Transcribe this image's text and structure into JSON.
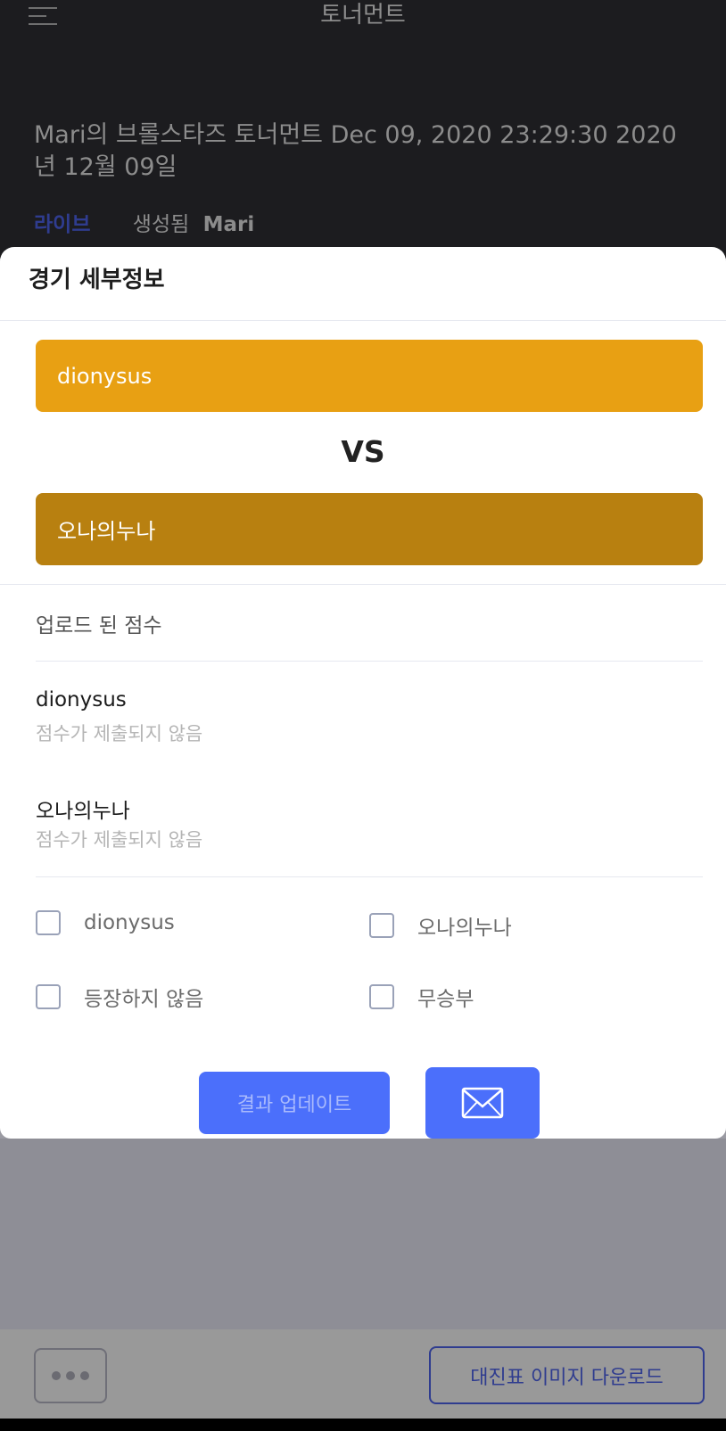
{
  "header": {
    "title": "토너먼트",
    "menu_icon": "hamburger-menu-icon"
  },
  "tournament": {
    "title": "Mari의 브롤스타즈 토너먼트 Dec 09, 2020 23:29:30 2020년 12월 09일",
    "status": "라이브",
    "created_label": "생성됨",
    "owner": "Mari"
  },
  "modal": {
    "title": "경기 세부정보",
    "team1": {
      "name": "dionysus",
      "color": "#e8a013"
    },
    "vs": "VS",
    "team2": {
      "name": "오나의누나",
      "color": "#b88010"
    },
    "scores_label": "업로드 된 점수",
    "scores": [
      {
        "name": "dionysus",
        "status": "점수가 제출되지 않음"
      },
      {
        "name": "오나의누나",
        "status": "점수가 제출되지 않음"
      }
    ],
    "options": [
      "dionysus",
      "오나의누나",
      "등장하지 않음",
      "무승부"
    ],
    "update_button": "결과 업데이트",
    "mail_icon": "envelope-icon",
    "accent_color": "#4b6ffb"
  },
  "footer": {
    "more_icon": "more-dots-icon",
    "download_button": "대진표 이미지 다운로드"
  }
}
